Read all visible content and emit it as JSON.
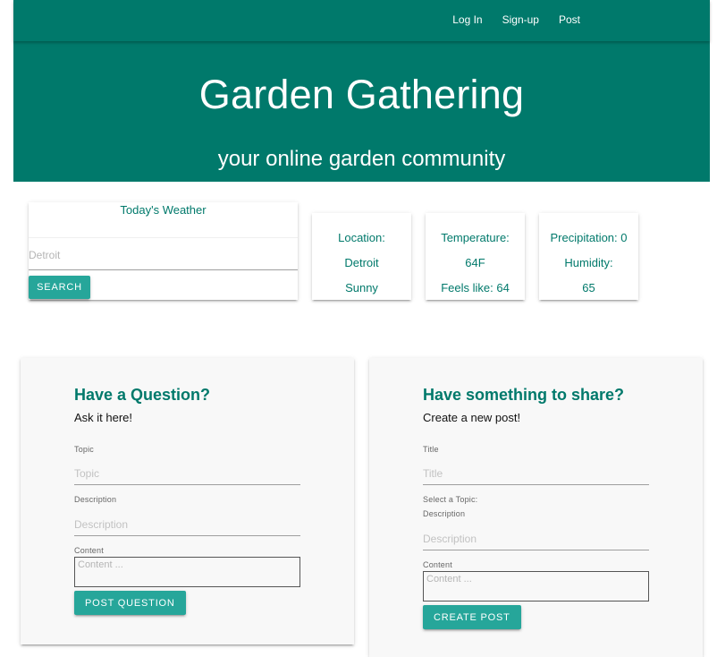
{
  "nav": {
    "login": "Log In",
    "signup": "Sign-up",
    "post": "Post"
  },
  "hero": {
    "title": "Garden Gathering",
    "subtitle": "your online garden community"
  },
  "weather": {
    "title": "Today's Weather",
    "input_placeholder": "Detroit",
    "search_label": "SEARCH",
    "location_label": "Location:",
    "location_value": "Detroit",
    "condition": "Sunny",
    "temperature_label": "Temperature:",
    "temperature_value": "64F",
    "feels_like": "Feels like: 64",
    "precipitation": "Precipitation: 0",
    "humidity_label": "Humidity:",
    "humidity_value": "65"
  },
  "question_form": {
    "heading": "Have a Question?",
    "subheading": "Ask it here!",
    "topic_label": "Topic",
    "topic_placeholder": "Topic",
    "description_label": "Description",
    "description_placeholder": "Description",
    "content_label": "Content",
    "content_placeholder": "Content ...",
    "submit_label": "POST QUESTION"
  },
  "post_form": {
    "heading": "Have something to share?",
    "subheading": "Create a new post!",
    "title_label": "Title",
    "title_placeholder": "Title",
    "topic_select_label": "Select a Topic:",
    "description_label": "Description",
    "description_placeholder": "Description",
    "content_label": "Content",
    "content_placeholder": "Content ...",
    "submit_label": "CREATE POST"
  },
  "colors": {
    "primary": "#00796b",
    "accent": "#26a69a",
    "form_background": "#f8f8f8"
  }
}
